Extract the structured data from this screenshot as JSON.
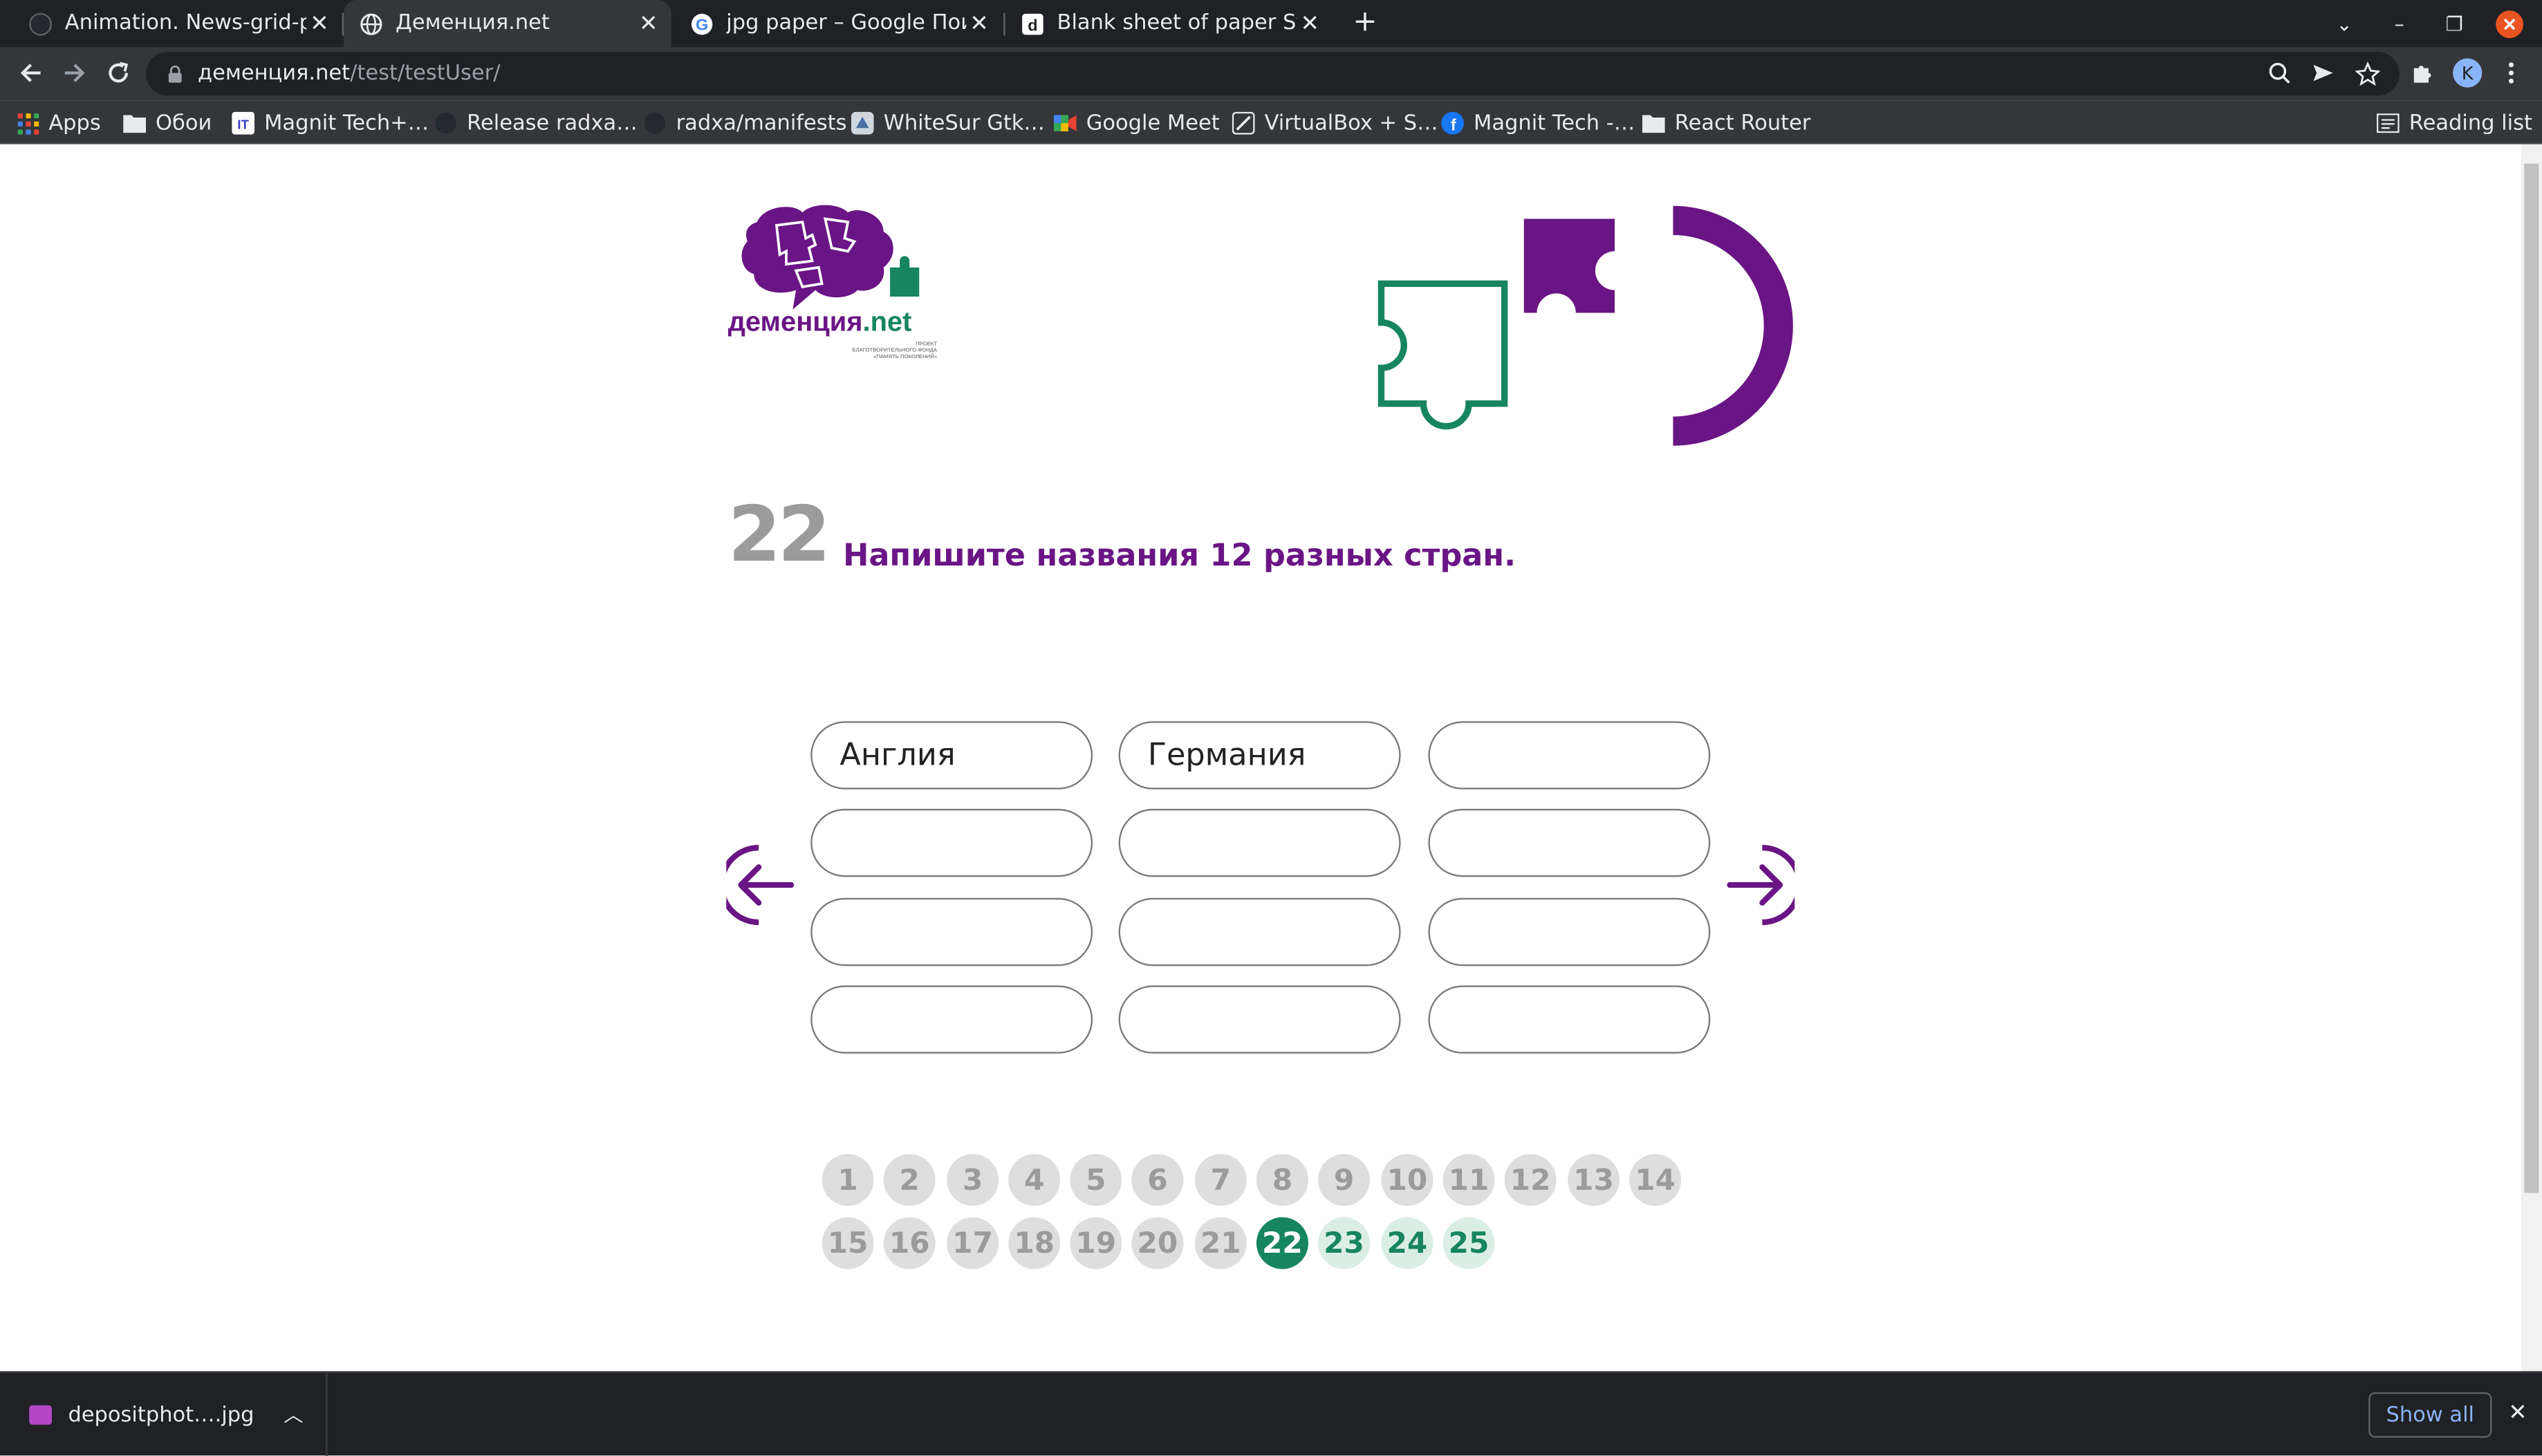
{
  "browser": {
    "tabs": [
      {
        "title": "Animation. News-grid-pag",
        "icon": "github-icon"
      },
      {
        "title": "Деменция.net",
        "icon": "globe-icon"
      },
      {
        "title": "jpg paper – Google Поиск",
        "icon": "google-icon"
      },
      {
        "title": "Blank sheet of paper Stoc",
        "icon": "depositphotos-icon"
      }
    ],
    "new_tab_label": "+",
    "url_host": "деменция.net",
    "url_path": "/test/testUser/",
    "avatar_letter": "K",
    "bookmarks": [
      {
        "label": "Apps",
        "icon": "apps-grid-icon"
      },
      {
        "label": "Обои",
        "icon": "folder-icon"
      },
      {
        "label": "Magnit Tech+…",
        "icon": "it-icon"
      },
      {
        "label": "Release radxa…",
        "icon": "github-icon"
      },
      {
        "label": "radxa/manifests",
        "icon": "github-icon"
      },
      {
        "label": "WhiteSur Gtk…",
        "icon": "whitesur-icon"
      },
      {
        "label": "Google Meet",
        "icon": "google-meet-icon"
      },
      {
        "label": "VirtualBox + S…",
        "icon": "virtualbox-icon"
      },
      {
        "label": "Magnit Tech -…",
        "icon": "facebook-icon"
      },
      {
        "label": "React Router",
        "icon": "folder-icon"
      }
    ],
    "reading_list": "Reading list"
  },
  "site": {
    "logo_text": "деменция.net",
    "logo_subtext": "ПРОЕКТ БЛАГОТВОРИТЕЛЬНОГО ФОНДА «ПАМЯТЬ ПОКОЛЕНИЙ»",
    "colors": {
      "purple": "#6a1585",
      "green": "#17855f",
      "grey": "#9b9b9b"
    }
  },
  "question": {
    "number": "22",
    "text": "Напишите названия 12 разных стран.",
    "answers": [
      "Англия",
      "Германия",
      "",
      "",
      "",
      "",
      "",
      "",
      "",
      "",
      "",
      ""
    ]
  },
  "navigation": {
    "prev_icon": "arrow-left-circle-icon",
    "next_icon": "arrow-right-circle-icon"
  },
  "pager": {
    "current": 22,
    "pages": [
      "1",
      "2",
      "3",
      "4",
      "5",
      "6",
      "7",
      "8",
      "9",
      "10",
      "11",
      "12",
      "13",
      "14",
      "15",
      "16",
      "17",
      "18",
      "19",
      "20",
      "21",
      "22",
      "23",
      "24",
      "25"
    ]
  },
  "downloads": {
    "file_name": "depositphot….jpg",
    "show_all": "Show all"
  }
}
